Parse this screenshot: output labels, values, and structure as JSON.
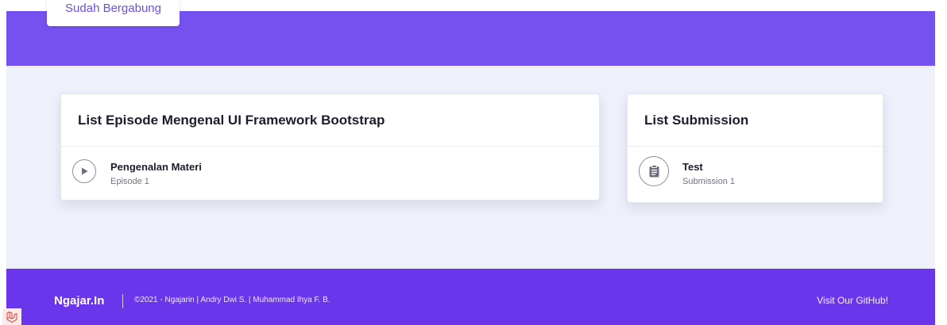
{
  "hero": {
    "joined_label": "Sudah Bergabung",
    "background_color": "#7551f0"
  },
  "episodes_card": {
    "title": "List Episode Mengenal UI Framework Bootstrap",
    "items": [
      {
        "title": "Pengenalan Materi",
        "subtitle": "Episode 1",
        "icon": "play-icon"
      }
    ]
  },
  "submissions_card": {
    "title": "List Submission",
    "items": [
      {
        "title": "Test",
        "subtitle": "Submission 1",
        "icon": "clipboard-icon"
      }
    ]
  },
  "footer": {
    "brand": "Ngajar.In",
    "copyright": "©2021 - Ngajarin | Andry Dwi S. | Muhammad Ihya F. B.",
    "github_link": "Visit Our GitHub!",
    "background_color": "#6b35ec"
  },
  "laravel_badge": {
    "icon": "laravel-icon"
  }
}
